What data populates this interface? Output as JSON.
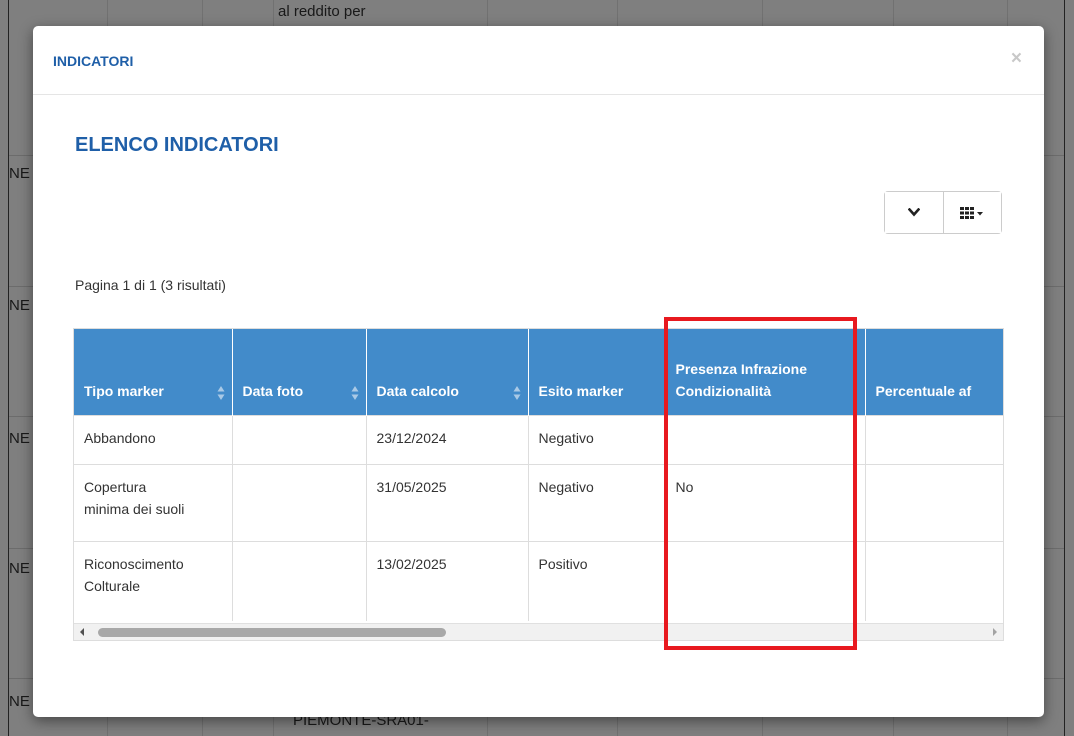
{
  "background": {
    "top_fragment": "al reddito per",
    "bottom_fragment": "PIEMONTE-SRA01-",
    "side_fragments": [
      "NE",
      "NE",
      "NE",
      "NE",
      "NE"
    ]
  },
  "modal": {
    "title": "INDICATORI",
    "close_label": "×",
    "section_title": "ELENCO INDICATORI",
    "pagination_info": "Pagina 1 di 1 (3 risultati)",
    "toolbar": {
      "collapse_icon": "chevron-down-icon",
      "columns_icon": "grid-columns-icon"
    }
  },
  "table": {
    "columns": [
      {
        "label": "Tipo marker",
        "sortable": true
      },
      {
        "label": "Data foto",
        "sortable": true
      },
      {
        "label": "Data calcolo",
        "sortable": true
      },
      {
        "label": "Esito marker",
        "sortable": false
      },
      {
        "label_line1": "Presenza Infrazione",
        "label_line2": "Condizionalità",
        "sortable": false
      },
      {
        "label": "Percentuale af",
        "sortable": false
      }
    ],
    "rows": [
      {
        "tipo": "Abbandono",
        "data_foto": "",
        "data_calcolo": "23/12/2024",
        "esito": "Negativo",
        "presenza": "",
        "percentuale": ""
      },
      {
        "tipo_line1": "Copertura",
        "tipo_line2": "minima dei suoli",
        "data_foto": "",
        "data_calcolo": "31/05/2025",
        "esito": "Negativo",
        "presenza": "No",
        "percentuale": ""
      },
      {
        "tipo_line1": "Riconoscimento",
        "tipo_line2": "Colturale",
        "data_foto": "",
        "data_calcolo": "13/02/2025",
        "esito": "Positivo",
        "presenza": "",
        "percentuale": ""
      }
    ]
  },
  "colors": {
    "header_bg": "#428bca",
    "title_blue": "#1f5fa8",
    "highlight_red": "#e8191f"
  }
}
